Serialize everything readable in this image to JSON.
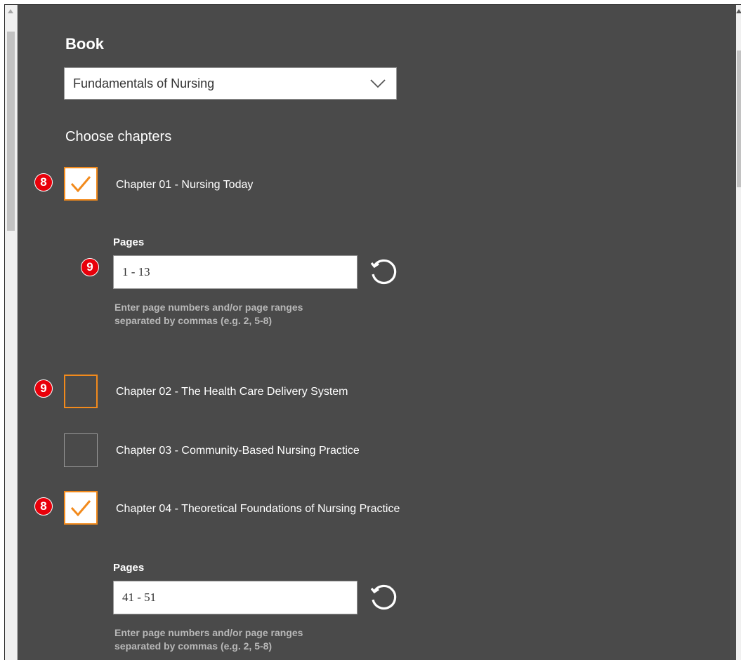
{
  "book": {
    "label": "Book",
    "selected": "Fundamentals of Nursing"
  },
  "choose_label": "Choose chapters",
  "chapters": [
    {
      "label": "Chapter 01 - Nursing Today",
      "checked": true,
      "badge": "8",
      "pages": {
        "label": "Pages",
        "value": "1 - 13",
        "badge": "9",
        "hint_line1": "Enter page numbers and/or page ranges",
        "hint_line2": "separated by commas (e.g. 2, 5-8)"
      }
    },
    {
      "label": "Chapter 02 - The Health Care Delivery System",
      "checked": false,
      "badge": "9"
    },
    {
      "label": "Chapter 03 - Community-Based Nursing Practice",
      "checked": false
    },
    {
      "label": "Chapter 04 - Theoretical Foundations of Nursing Practice",
      "checked": true,
      "badge": "8",
      "pages": {
        "label": "Pages",
        "value": "41 - 51",
        "hint_line1": "Enter page numbers and/or page ranges",
        "hint_line2": "separated by commas (e.g. 2, 5-8)"
      }
    }
  ],
  "colors": {
    "panel_bg": "#4a4a4a",
    "accent_orange": "#f28a1c",
    "badge_red": "#e8000a"
  },
  "icons": {
    "dropdown": "chevron-down-icon",
    "checkmark": "checkmark-icon",
    "reset": "reset-icon"
  }
}
